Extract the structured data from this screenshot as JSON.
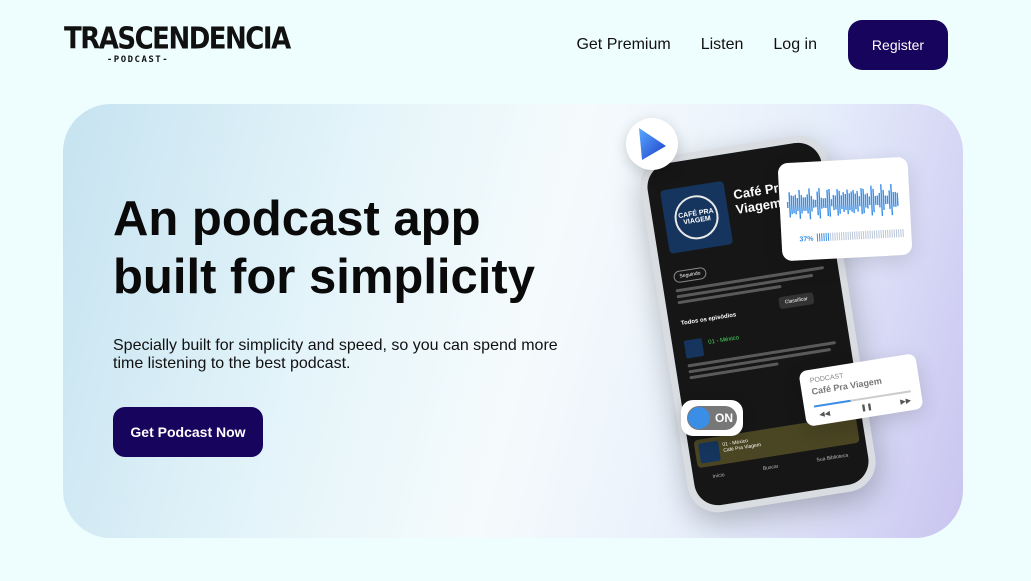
{
  "brand": {
    "name": "TRASCENDENCIA",
    "tagline": "-PODCAST-"
  },
  "nav": {
    "links": [
      "Get Premium",
      "Listen",
      "Log in"
    ],
    "register_label": "Register"
  },
  "hero": {
    "title": "An podcast app built for simplicity",
    "description": "Specially built for simplicity and speed, so you can spend more time listening to the best podcast.",
    "cta_label": "Get Podcast Now"
  },
  "illustration": {
    "show_title": "Café Pra Viagem",
    "cover_text": "CAFÉ PRA VIAGEM",
    "follow_label": "Seguindo",
    "order_label": "Classificar",
    "episodes_label": "Todos os episódios",
    "episode_title": "01 - México",
    "now_playing_title": "01 - México",
    "now_playing_show": "Café Pra Viagem",
    "tabs": [
      "Início",
      "Buscar",
      "Sua Biblioteca"
    ],
    "wave_percent": "37%",
    "mini_player_label": "PODCAST",
    "mini_player_title": "Café Pra Viagem",
    "mini_player_progress": 0.38,
    "toggle_label": "ON"
  },
  "colors": {
    "primary": "#17045d",
    "background": "#eefdfd",
    "accent_blue": "#3a8ee6"
  }
}
